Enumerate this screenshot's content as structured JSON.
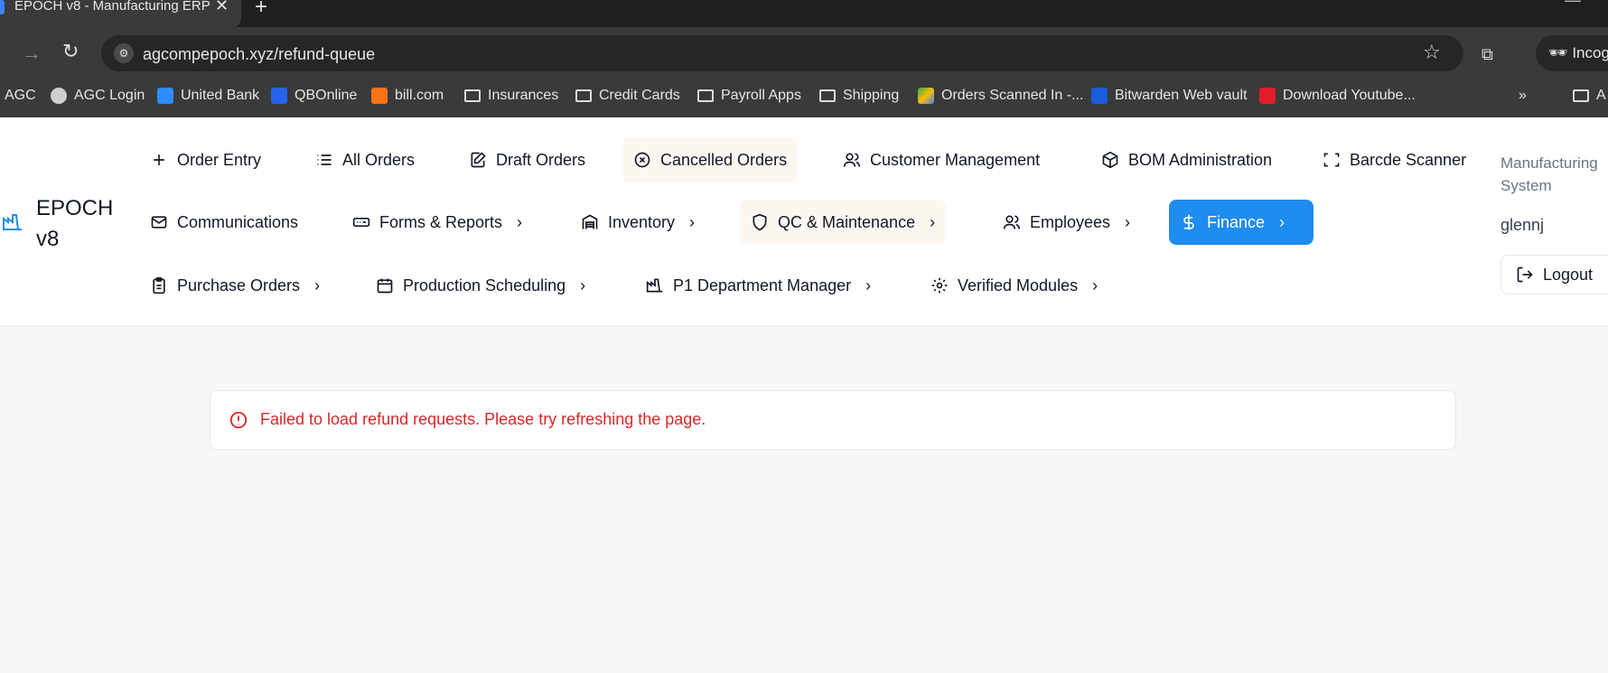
{
  "browser": {
    "tab_title": "EPOCH v8 - Manufacturing ERP",
    "tab_close": "✕",
    "new_tab": "+",
    "url": "agcompepoch.xyz/refund-queue",
    "incognito_label": "Incog",
    "bookmarks": [
      {
        "label": "AGC",
        "icon": "none"
      },
      {
        "label": "AGC Login",
        "icon": "globe-icon"
      },
      {
        "label": "United Bank",
        "icon": "bank-icon",
        "color": "#2d8cff"
      },
      {
        "label": "QBOnline",
        "icon": "qb-icon",
        "color": "#2563eb"
      },
      {
        "label": "bill.com",
        "icon": "bill-icon",
        "color": "#f97316"
      },
      {
        "label": "Insurances",
        "icon": "folder-icon"
      },
      {
        "label": "Credit Cards",
        "icon": "folder-icon"
      },
      {
        "label": "Payroll Apps",
        "icon": "folder-icon"
      },
      {
        "label": "Shipping",
        "icon": "folder-icon"
      },
      {
        "label": "Orders Scanned In -...",
        "icon": "drive-icon"
      },
      {
        "label": "Bitwarden Web vault",
        "icon": "bitwarden-icon",
        "color": "#175ddc"
      },
      {
        "label": "Download Youtube...",
        "icon": "youtube-dl-icon",
        "color": "#e11d2a"
      }
    ],
    "bookmarks_overflow": "»",
    "bookmarks_trailing": "A"
  },
  "app": {
    "brand": "EPOCH v8",
    "system_label": "Manufacturing System",
    "username": "glennj",
    "logout_label": "Logout",
    "nav_rows": [
      [
        {
          "label": "Order Entry",
          "icon": "plus-icon"
        },
        {
          "label": "All Orders",
          "icon": "list-icon"
        },
        {
          "label": "Draft Orders",
          "icon": "edit-icon"
        },
        {
          "label": "Cancelled Orders",
          "icon": "x-circle-icon",
          "state": "highlighted"
        },
        {
          "label": "Customer Management",
          "icon": "users-icon"
        },
        {
          "label": "BOM Administration",
          "icon": "box-icon"
        },
        {
          "label": "Barcde Scanner",
          "icon": "scan-icon"
        }
      ],
      [
        {
          "label": "Communications",
          "icon": "mail-icon"
        },
        {
          "label": "Forms & Reports",
          "icon": "form-icon",
          "submenu": true
        },
        {
          "label": "Inventory",
          "icon": "warehouse-icon",
          "submenu": true
        },
        {
          "label": "QC & Maintenance",
          "icon": "shield-icon",
          "submenu": true,
          "state": "highlighted"
        },
        {
          "label": "Employees",
          "icon": "users-icon",
          "submenu": true
        },
        {
          "label": "Finance",
          "icon": "dollar-icon",
          "submenu": true,
          "state": "active"
        }
      ],
      [
        {
          "label": "Purchase Orders",
          "icon": "clipboard-icon",
          "submenu": true
        },
        {
          "label": "Production Scheduling",
          "icon": "calendar-icon",
          "submenu": true
        },
        {
          "label": "P1 Department Manager",
          "icon": "factory-icon",
          "submenu": true
        },
        {
          "label": "Verified Modules",
          "icon": "gear-icon",
          "submenu": true
        }
      ]
    ]
  },
  "error": {
    "message": "Failed to load refund requests. Please try refreshing the page.",
    "color": "#dc2626"
  },
  "colors": {
    "accent": "#1f8cf0",
    "highlight_bg": "#fdf7f2"
  }
}
